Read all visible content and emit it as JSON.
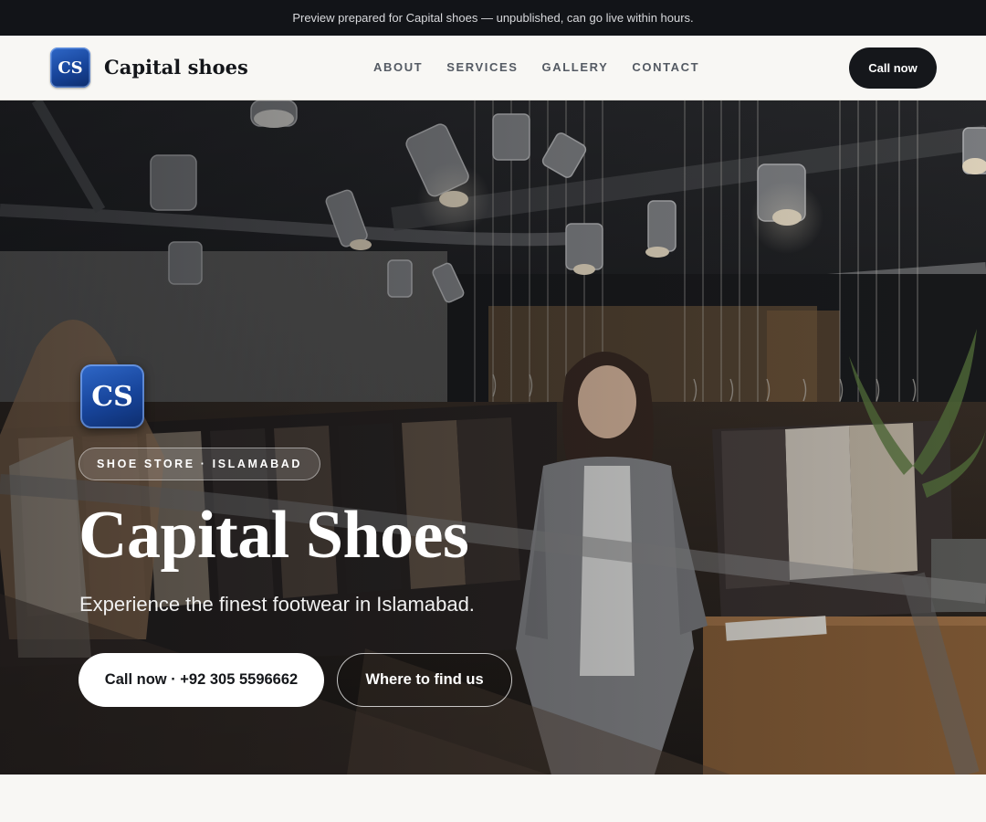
{
  "preview_banner": "Preview prepared for Capital shoes — unpublished, can go live within hours.",
  "brand": {
    "logo_text": "CS",
    "name": "Capital shoes",
    "logo_color": "#1f4fa8"
  },
  "nav": {
    "links": [
      "ABOUT",
      "SERVICES",
      "GALLERY",
      "CONTACT"
    ],
    "cta_label": "Call now"
  },
  "hero": {
    "logo_text": "CS",
    "tag": "SHOE STORE · ISLAMABAD",
    "title": "Capital Shoes",
    "subtitle": "Experience the finest footwear in Islamabad.",
    "primary_cta": "Call now · +92 305 5596662",
    "secondary_cta": "Where to find us",
    "background_image": "store-interior-photo"
  },
  "colors": {
    "dark": "#15171b",
    "page_bg": "#f8f7f4",
    "accent_blue": "#1f4fa8"
  }
}
